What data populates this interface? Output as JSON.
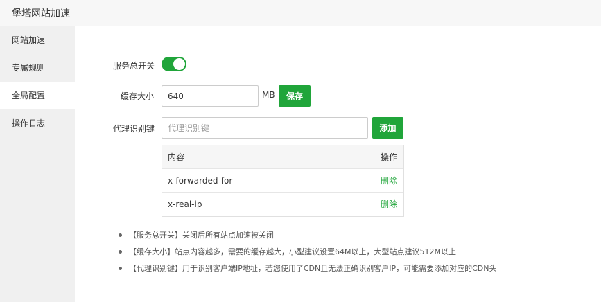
{
  "window": {
    "title": "堡塔网站加速"
  },
  "sidebar": {
    "items": [
      {
        "label": "网站加速"
      },
      {
        "label": "专属规则"
      },
      {
        "label": "全局配置"
      },
      {
        "label": "操作日志"
      }
    ],
    "active_index": 2
  },
  "form": {
    "service_switch": {
      "label": "服务总开关",
      "enabled": true
    },
    "cache_size": {
      "label": "缓存大小",
      "value": "640",
      "unit": "MB",
      "save_label": "保存"
    },
    "proxy_key": {
      "label": "代理识别键",
      "placeholder": "代理识别键",
      "add_label": "添加"
    }
  },
  "table": {
    "headers": {
      "content": "内容",
      "action": "操作"
    },
    "rows": [
      {
        "content": "x-forwarded-for",
        "action": "删除"
      },
      {
        "content": "x-real-ip",
        "action": "删除"
      }
    ]
  },
  "tips": [
    "【服务总开关】关闭后所有站点加速被关闭",
    "【缓存大小】站点内容越多，需要的缓存越大，小型建议设置64M以上，大型站点建议512M以上",
    "【代理识别键】用于识别客户端IP地址，若您使用了CDN且无法正确识别客户IP，可能需要添加对应的CDN头"
  ],
  "colors": {
    "accent": "#20a53a",
    "sidebar_bg": "#f0f0f0",
    "titlebar_bg": "#f7f7f7"
  }
}
